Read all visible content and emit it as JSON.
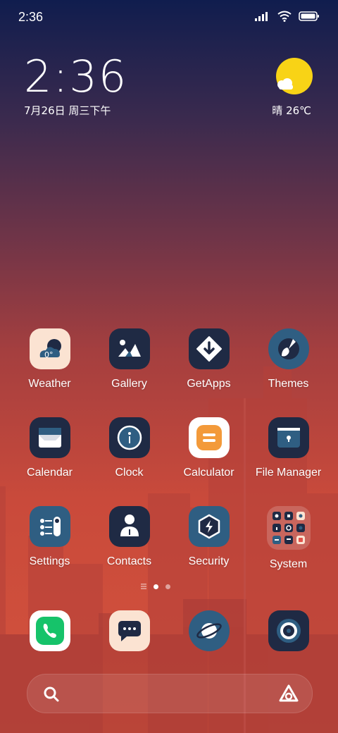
{
  "status_bar": {
    "time": "2:36"
  },
  "clock": {
    "time": "2:36",
    "date": "7月26日 周三下午"
  },
  "weather": {
    "condition": "晴",
    "temperature": "26℃",
    "icon": "sunny-cloud-icon"
  },
  "apps": [
    {
      "label": "Weather",
      "icon": "weather-icon",
      "icon_badge": "0°"
    },
    {
      "label": "Gallery",
      "icon": "gallery-icon"
    },
    {
      "label": "GetApps",
      "icon": "getapps-icon"
    },
    {
      "label": "Themes",
      "icon": "themes-icon"
    },
    {
      "label": "Calendar",
      "icon": "calendar-icon"
    },
    {
      "label": "Clock",
      "icon": "clock-icon"
    },
    {
      "label": "Calculator",
      "icon": "calculator-icon"
    },
    {
      "label": "File Manager",
      "icon": "file-manager-icon"
    },
    {
      "label": "Settings",
      "icon": "settings-icon"
    },
    {
      "label": "Contacts",
      "icon": "contacts-icon"
    },
    {
      "label": "Security",
      "icon": "security-icon"
    },
    {
      "label": "System",
      "icon": "system-folder-icon"
    }
  ],
  "dock": [
    {
      "icon": "phone-icon"
    },
    {
      "icon": "messages-icon"
    },
    {
      "icon": "browser-icon"
    },
    {
      "icon": "camera-icon"
    }
  ],
  "page_indicator": {
    "pages": 2,
    "current": 1
  },
  "search": {
    "icon": "search-icon",
    "assistant_icon": "assistant-icon"
  },
  "colors": {
    "navy_icon": "#1f2a44",
    "blue_icon": "#2f5e82",
    "weather_bg": "#fbe3d2",
    "calc_orange": "#f39a3a",
    "phone_green": "#16c36a"
  }
}
